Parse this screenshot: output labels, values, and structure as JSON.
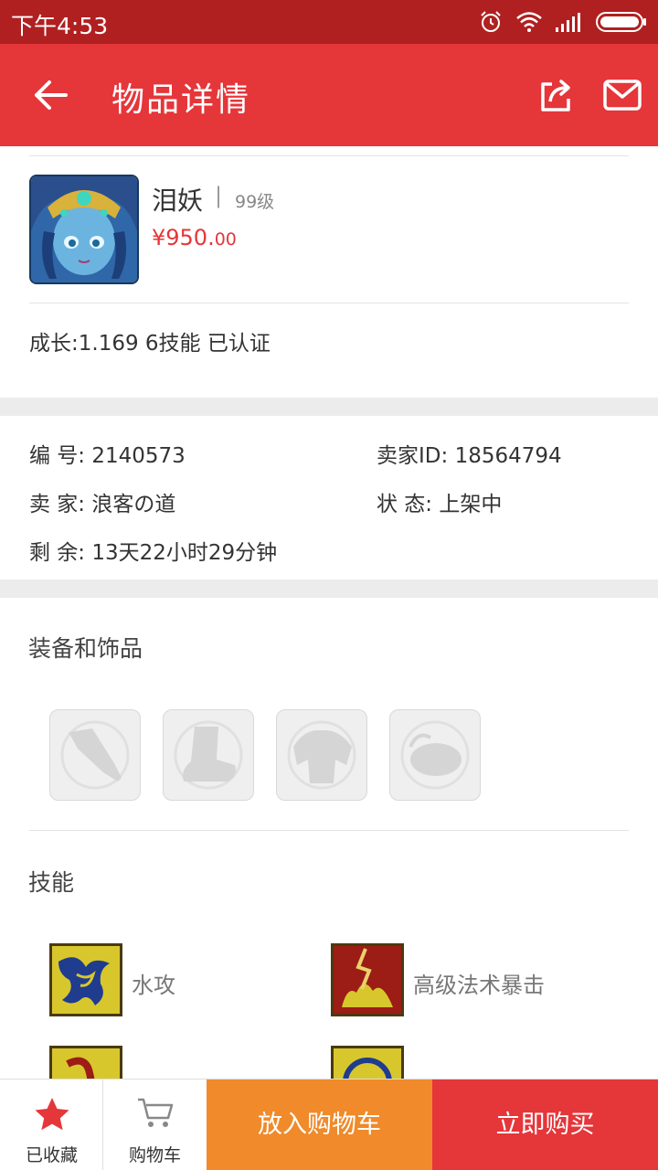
{
  "status_bar": {
    "time": "下午4:53",
    "icons": [
      "alarm-icon",
      "wifi-icon",
      "signal-icon",
      "battery-icon"
    ]
  },
  "app_bar": {
    "title": "物品详情",
    "icons": [
      "back-arrow-icon",
      "share-icon",
      "mail-icon"
    ]
  },
  "item": {
    "name": "泪妖",
    "separator": "|",
    "level": "99级",
    "price_main": "¥950.",
    "price_decimal": "00",
    "growth_line": "成长:1.169 6技能 已认证"
  },
  "details": {
    "number_label": "编  号: ",
    "number_value": "2140573",
    "seller_id_label": "卖家ID: ",
    "seller_id_value": "18564794",
    "seller_label": "卖  家: ",
    "seller_value": "浪客の道",
    "status_label": "状  态: ",
    "status_value": "上架中",
    "remaining_label": "剩  余: ",
    "remaining_value": "13天22小时29分钟"
  },
  "equipment": {
    "title": "装备和饰品",
    "slots": [
      "weapon-slot-icon",
      "boots-slot-icon",
      "armor-slot-icon",
      "accessory-slot-icon"
    ]
  },
  "skills": {
    "title": "技能",
    "items": [
      {
        "label": "水攻",
        "icon": "water-attack-skill-icon"
      },
      {
        "label": "高级法术暴击",
        "icon": "spell-crit-skill-icon"
      },
      {
        "label": "...",
        "icon": "skill-icon"
      },
      {
        "label": "...",
        "icon": "skill-icon"
      }
    ]
  },
  "bottom_bar": {
    "favorite_label": "已收藏",
    "cart_label": "购物车",
    "add_to_cart_label": "放入购物车",
    "buy_now_label": "立即购买"
  },
  "colors": {
    "status_bar": "#b02020",
    "app_bar": "#e5363a",
    "price": "#e5363a",
    "add_to_cart": "#f08a2a",
    "buy_now": "#e5363a",
    "favorite_star": "#e5363a"
  }
}
